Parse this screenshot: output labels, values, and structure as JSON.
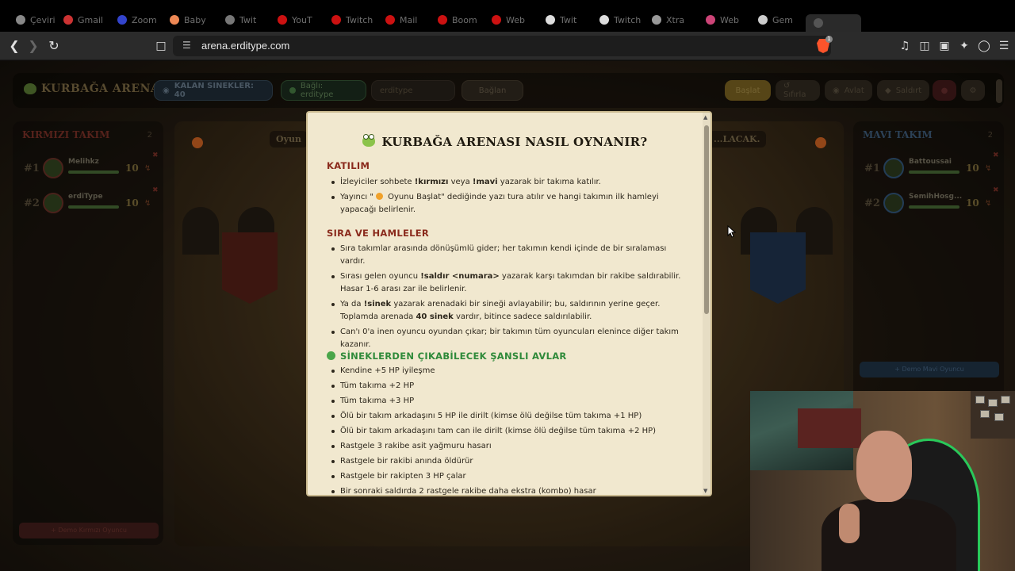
{
  "browser": {
    "url": "arena.erditype.com",
    "brave_badge": "1",
    "tabs": [
      "Çeviri",
      "Gmail",
      "Zoom",
      "Baby",
      "Twit",
      "YouT",
      "Twitch",
      "Mail",
      "Boom",
      "Web",
      "Twit",
      "Twitch",
      "Xtra",
      "Web",
      "Gem"
    ]
  },
  "game": {
    "logo": "KURBAĞA ARENASI",
    "remaining_flies": "KALAN SINEKLER: 40",
    "connection": "Bağlı: erditype",
    "channel_value": "erditype",
    "connect_button": "Bağlan",
    "buttons": {
      "start": "Başlat",
      "reset": "↺ Sıfırla",
      "hunt": "Avlat",
      "attack": "Saldırt"
    },
    "arena_message_left": "Oyun",
    "arena_message_right": "...LACAK.",
    "red_team": {
      "title": "KIRMIZI TAKIM",
      "count": "2",
      "players": [
        {
          "rank": "#1",
          "name": "Melihkz",
          "hp": "10"
        },
        {
          "rank": "#2",
          "name": "erdiType",
          "hp": "10"
        }
      ],
      "demo_button": "+ Demo Kırmızı Oyuncu"
    },
    "blue_team": {
      "title": "MAVI TAKIM",
      "count": "2",
      "players": [
        {
          "rank": "#1",
          "name": "Battoussai",
          "hp": "10"
        },
        {
          "rank": "#2",
          "name": "SemihHosg...",
          "hp": "10"
        }
      ],
      "demo_button": "+ Demo Mavi Oyuncu"
    }
  },
  "modal": {
    "title": "KURBAĞA ARENASI NASIL OYNANIR?",
    "sections": {
      "katilim": {
        "heading": "KATILIM",
        "item1_a": "İzleyiciler sohbete ",
        "item1_b": "!kırmızı",
        "item1_c": " veya ",
        "item1_d": "!mavi",
        "item1_e": " yazarak bir takıma katılır.",
        "item2_a": "Yayıncı \"",
        "item2_b": " Oyunu Başlat\" dediğinde yazı tura atılır ve hangi takımın ilk hamleyi yapacağı belirlenir."
      },
      "sira": {
        "heading": "SIRA VE HAMLELER",
        "item1": "Sıra takımlar arasında dönüşümlü gider; her takımın kendi içinde de bir sıralaması vardır.",
        "item2_a": "Sırası gelen oyuncu ",
        "item2_b": "!saldır <numara>",
        "item2_c": " yazarak karşı takımdan bir rakibe saldırabilir. Hasar 1-6 arası zar ile belirlenir.",
        "item3_a": "Ya da ",
        "item3_b": "!sinek",
        "item3_c": " yazarak arenadaki bir sineği avlayabilir; bu, saldırının yerine geçer. Toplamda arenada ",
        "item3_d": "40 sinek",
        "item3_e": " vardır, bitince sadece saldırılabilir.",
        "item4": "Can'ı 0'a inen oyuncu oyundan çıkar; bir takımın tüm oyuncuları elenince diğer takım kazanır."
      },
      "avlar": {
        "heading": "SİNEKLERDEN ÇIKABİLECEK ŞANSLI AVLAR",
        "items": [
          "Kendine +5 HP iyileşme",
          "Tüm takıma +2 HP",
          "Tüm takıma +3 HP",
          "Ölü bir takım arkadaşını 5 HP ile dirilt (kimse ölü değilse tüm takıma +1 HP)",
          "Ölü bir takım arkadaşını tam can ile dirilt (kimse ölü değilse tüm takıma +2 HP)",
          "Rastgele 3 rakibe asit yağmuru hasarı",
          "Rastgele bir rakibi anında öldürür",
          "Rastgele bir rakipten 3 HP çalar",
          "Bir sonraki saldırda 2 rastgele rakibe daha ekstra (kombo) hasar"
        ]
      }
    }
  },
  "colors": {
    "modal_bg": "#f1e8cf",
    "heading_red": "#8a2a1c",
    "heading_green": "#2f8a3a",
    "webcam_chair_accent": "#29c95a"
  }
}
